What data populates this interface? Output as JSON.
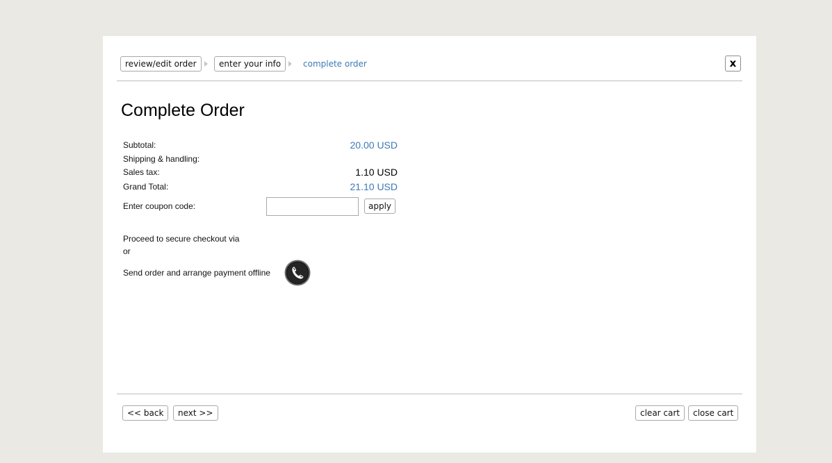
{
  "breadcrumb": {
    "steps": [
      {
        "label": "review/edit order"
      },
      {
        "label": "enter your info"
      },
      {
        "label": "complete order"
      }
    ]
  },
  "close_label": "x",
  "page_title": "Complete Order",
  "summary": {
    "subtotal": {
      "label": "Subtotal:",
      "value": "20.00 USD"
    },
    "shipping": {
      "label": "Shipping & handling:",
      "value": ""
    },
    "tax": {
      "label": "Sales tax:",
      "value": "1.10 USD"
    },
    "grand_total": {
      "label": "Grand Total:",
      "value": "21.10 USD"
    }
  },
  "coupon": {
    "label": "Enter coupon code:",
    "value": "",
    "placeholder": "",
    "apply_label": "apply"
  },
  "checkout": {
    "secure_text": "Proceed to secure checkout via",
    "or_text": "or",
    "offline_text": "Send order and arrange payment offline",
    "offline_icon": "phone-icon"
  },
  "footer": {
    "back_label": "<< back",
    "next_label": "next >>",
    "clear_label": "clear cart",
    "close_label": "close cart"
  },
  "colors": {
    "accent": "#3d79b8",
    "page_background": "#eae9e4",
    "panel_background": "#ffffff"
  }
}
